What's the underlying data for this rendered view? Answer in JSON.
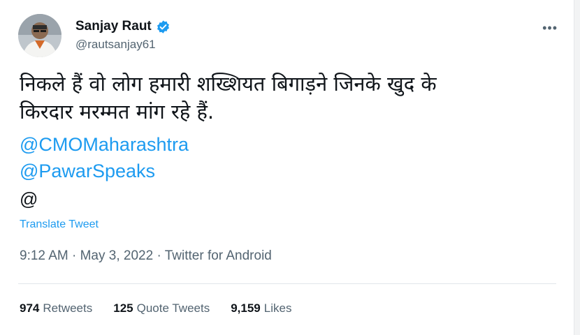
{
  "author": {
    "display_name": "Sanjay Raut",
    "handle": "@rautsanjay61",
    "verified_icon": "verified-badge-icon",
    "avatar_icon": "profile-avatar"
  },
  "more_icon": "more-horizontal-icon",
  "tweet": {
    "text": "निकले हैं वो लोग हमारी शख्शियत बिगाड़ने जिनके खुद के\nकिरदार मरम्मत मांग रहे हैं.",
    "mentions": [
      "@CMOMaharashtra",
      "@PawarSpeaks"
    ],
    "trailing": "@",
    "translate_label": "Translate Tweet"
  },
  "meta": {
    "time": "9:12 AM",
    "date": "May 3, 2022",
    "source": "Twitter for Android",
    "separator": " · "
  },
  "stats": {
    "retweets_count": "974",
    "retweets_label": "Retweets",
    "quotes_count": "125",
    "quotes_label": "Quote Tweets",
    "likes_count": "9,159",
    "likes_label": "Likes"
  },
  "colors": {
    "link": "#1d9bf0",
    "secondary_text": "#536471",
    "primary_text": "#0f1419"
  }
}
